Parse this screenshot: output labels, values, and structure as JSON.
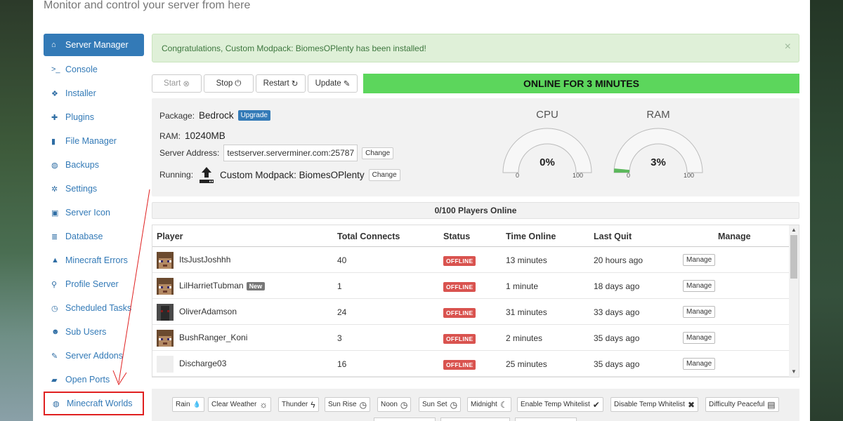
{
  "header": {
    "subtitle": "Monitor and control your server from here"
  },
  "sidebar": {
    "items": [
      {
        "label": "Server Manager",
        "icon": "home-icon",
        "glyph": "⌂"
      },
      {
        "label": "Console",
        "icon": "terminal-icon",
        "glyph": ">_"
      },
      {
        "label": "Installer",
        "icon": "cubes-icon",
        "glyph": "❖"
      },
      {
        "label": "Plugins",
        "icon": "puzzle-icon",
        "glyph": "✚"
      },
      {
        "label": "File Manager",
        "icon": "file-icon",
        "glyph": "▮"
      },
      {
        "label": "Backups",
        "icon": "globe-icon",
        "glyph": "◍"
      },
      {
        "label": "Settings",
        "icon": "gear-icon",
        "glyph": "✲"
      },
      {
        "label": "Server Icon",
        "icon": "image-icon",
        "glyph": "▣"
      },
      {
        "label": "Database",
        "icon": "database-icon",
        "glyph": "≣"
      },
      {
        "label": "Minecraft Errors",
        "icon": "warning-icon",
        "glyph": "▲"
      },
      {
        "label": "Profile Server",
        "icon": "search-icon",
        "glyph": "⚲"
      },
      {
        "label": "Scheduled Tasks",
        "icon": "clock-icon",
        "glyph": "◷"
      },
      {
        "label": "Sub Users",
        "icon": "users-icon",
        "glyph": "☻"
      },
      {
        "label": "Server Addons",
        "icon": "plug-icon",
        "glyph": "✎"
      },
      {
        "label": "Open Ports",
        "icon": "unlock-icon",
        "glyph": "▰"
      },
      {
        "label": "Minecraft Worlds",
        "icon": "globe-icon",
        "glyph": "◍"
      }
    ]
  },
  "alert": {
    "message": "Congratulations, Custom Modpack: BiomesOPlenty has been installed!",
    "close": "×"
  },
  "controls": {
    "start": "Start",
    "stop": "Stop",
    "restart": "Restart",
    "update": "Update",
    "start_glyph": "⊗",
    "stop_glyph": "⏻",
    "restart_glyph": "↻",
    "update_glyph": "✎"
  },
  "status": {
    "online": "ONLINE FOR 3 MINUTES"
  },
  "info": {
    "package_label": "Package:",
    "package_value": "Bedrock",
    "upgrade": "Upgrade",
    "ram_label": "RAM:",
    "ram_value": "10240MB",
    "address_label": "Server Address:",
    "address_value": "testserver.serverminer.com:25787",
    "change": "Change",
    "running_label": "Running:",
    "running_value": "Custom Modpack: BiomesOPlenty"
  },
  "gauges": {
    "cpu": {
      "title": "CPU",
      "value_text": "0%",
      "value": 0,
      "min": "0",
      "max": "100"
    },
    "ram": {
      "title": "RAM",
      "value_text": "3%",
      "value": 3,
      "min": "0",
      "max": "100"
    }
  },
  "players": {
    "summary": "0/100 Players Online",
    "columns": [
      "Player",
      "Total Connects",
      "Status",
      "Time Online",
      "Last Quit",
      "Manage"
    ],
    "rows": [
      {
        "name": "ItsJustJoshhh",
        "connects": "40",
        "status": "OFFLINE",
        "time": "13 minutes",
        "last": "20 hours ago",
        "manage": "Manage",
        "badge": ""
      },
      {
        "name": "LilHarrietTubman",
        "connects": "1",
        "status": "OFFLINE",
        "time": "1 minute",
        "last": "18 days ago",
        "manage": "Manage",
        "badge": "New"
      },
      {
        "name": "OliverAdamson",
        "connects": "24",
        "status": "OFFLINE",
        "time": "31 minutes",
        "last": "33 days ago",
        "manage": "Manage",
        "badge": ""
      },
      {
        "name": "BushRanger_Koni",
        "connects": "3",
        "status": "OFFLINE",
        "time": "2 minutes",
        "last": "35 days ago",
        "manage": "Manage",
        "badge": ""
      },
      {
        "name": "Discharge03",
        "connects": "16",
        "status": "OFFLINE",
        "time": "25 minutes",
        "last": "35 days ago",
        "manage": "Manage",
        "badge": ""
      }
    ]
  },
  "world_controls": [
    {
      "label": "Rain",
      "glyph": "💧",
      "icon": "raindrop-icon"
    },
    {
      "label": "Clear Weather",
      "glyph": "☼",
      "icon": "sun-icon"
    },
    {
      "label": "Thunder",
      "glyph": "ϟ",
      "icon": "bolt-icon"
    },
    {
      "label": "Sun Rise",
      "glyph": "◷",
      "icon": "clock-icon"
    },
    {
      "label": "Noon",
      "glyph": "◷",
      "icon": "clock-icon"
    },
    {
      "label": "Sun Set",
      "glyph": "◷",
      "icon": "clock-icon"
    },
    {
      "label": "Midnight",
      "glyph": "☾",
      "icon": "moon-icon"
    },
    {
      "label": "Enable Temp Whitelist",
      "glyph": "✔",
      "icon": "check-icon"
    },
    {
      "label": "Disable Temp Whitelist",
      "glyph": "✖",
      "icon": "x-icon"
    },
    {
      "label": "Difficulty Peaceful",
      "glyph": "▤",
      "icon": "book-icon"
    }
  ],
  "colors": {
    "accent": "#337ab7",
    "online": "#5cd65c",
    "offline": "#d9534f",
    "highlight": "#e02020"
  }
}
